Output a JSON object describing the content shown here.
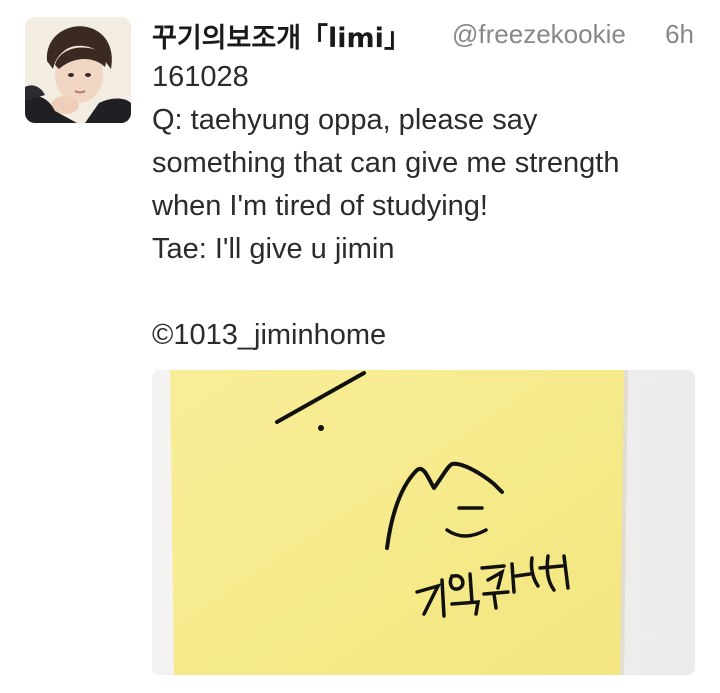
{
  "tweet": {
    "display_name": "꾸기의보조개「limi」",
    "handle": "@freezekookie",
    "timestamp": "6h",
    "lines": [
      "161028",
      "Q: taehyung oppa, please say",
      "something that can give me strength",
      "when I'm tired of studying!",
      "Tae: I'll give u jimin",
      "",
      "©1013_jiminhome"
    ]
  },
  "media": {
    "description_icon": "sticky-note-photo",
    "note_color": "#f6eb8f",
    "signature_text": "지민줄께"
  },
  "avatar": {
    "icon": "user-avatar-photo"
  }
}
